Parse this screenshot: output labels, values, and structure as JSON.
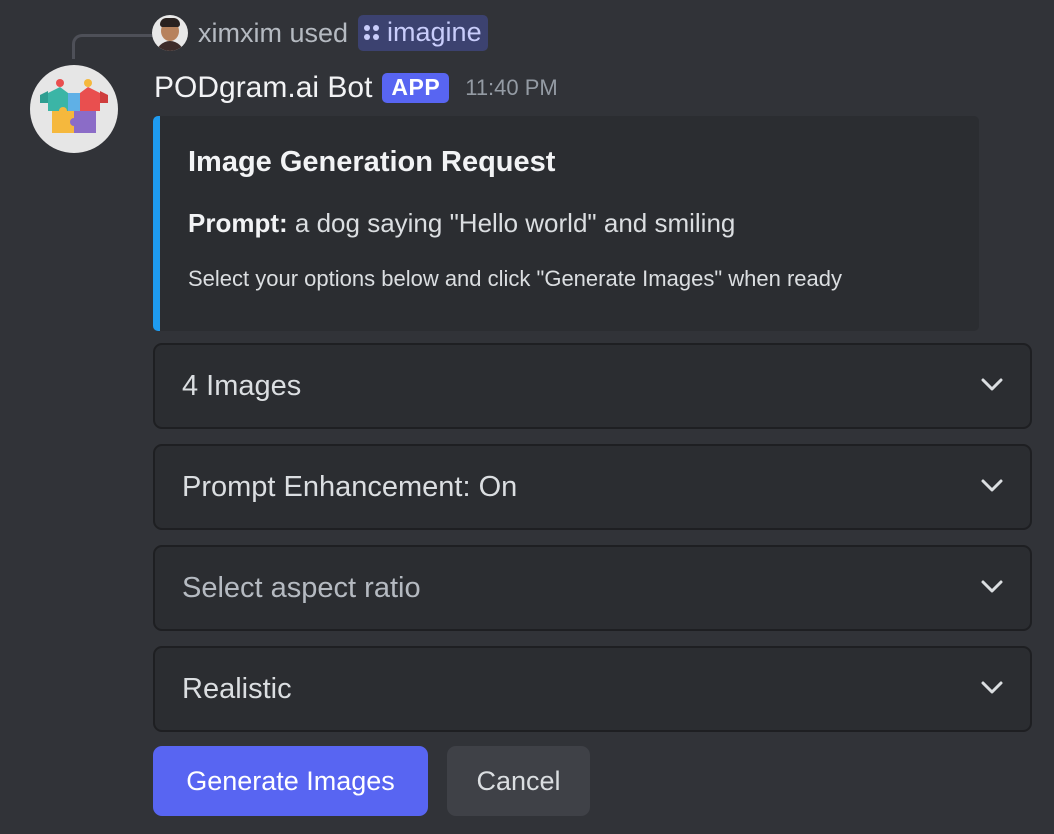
{
  "reply": {
    "user": "ximxim used",
    "command": "imagine"
  },
  "message": {
    "bot_name": "PODgram.ai Bot",
    "badge": "APP",
    "timestamp": "11:40 PM"
  },
  "embed": {
    "title": "Image Generation Request",
    "prompt_label": "Prompt:",
    "prompt_text": "a dog saying \"Hello world\" and smiling",
    "hint": "Select your options below and click \"Generate Images\" when ready",
    "accent_color": "#1e9bf0"
  },
  "selects": [
    {
      "value": "4 Images"
    },
    {
      "value": "Prompt Enhancement: On"
    },
    {
      "value": "Select aspect ratio"
    },
    {
      "value": "Realistic"
    }
  ],
  "buttons": {
    "generate": "Generate Images",
    "cancel": "Cancel"
  },
  "colors": {
    "background": "#313338",
    "embed_bg": "#2b2d31",
    "brand": "#5865f2"
  }
}
